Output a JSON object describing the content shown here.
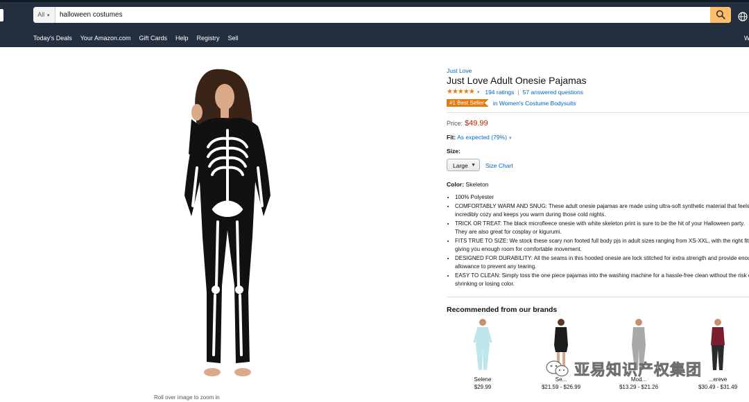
{
  "header": {
    "search_category": "All",
    "search_query": "halloween costumes",
    "nav_links": [
      "Today's Deals",
      "Your Amazon.com",
      "Gift Cards",
      "Help",
      "Registry",
      "Sell"
    ],
    "nav_edge": "W",
    "accent_color": "#febd69",
    "bar_color": "#232f3e"
  },
  "product": {
    "brand": "Just Love",
    "title": "Just Love Adult Onesie Pajamas",
    "stars": "★★★★★",
    "ratings_text": "194 ratings",
    "answered_text": "57 answered questions",
    "best_seller_badge": "#1 Best Seller",
    "best_seller_category": "in Women's Costume Bodysuits",
    "price_label": "Price:",
    "price": "$49.99",
    "fit_label": "Fit:",
    "fit_value": "As expected (79%)",
    "size_label": "Size:",
    "size_selected": "Large",
    "size_chart_link": "Size Chart",
    "color_label": "Color:",
    "color_value": "Skeleton",
    "bullets": [
      "100% Polyester",
      "COMFORTABLY WARM AND SNUG: These adult onesie pajamas are made using ultra-soft synthetic material that feels incredibly cozy and keeps you warm during those cold nights.",
      "TRICK OR TREAT: The black microfleece onesie with white skeleton print is sure to be the hit of your Halloween party. They are also great for cosplay or kigurumi.",
      "FITS TRUE TO SIZE: We stock these scary non footed full body pjs in adult sizes ranging from XS-XXL, with the right fit giving you enough room for comfortable movement.",
      "DESIGNED FOR DURABILITY: All the seams in this hooded onesie are lock stitched for extra strength and provide enough allowance to prevent any tearing.",
      "EASY TO CLEAN: Simply toss the one piece pajamas into the washing machine for a hassle-free clean without the risk of shrinking or losing color."
    ],
    "image_caption": "Roll over image to zoom in",
    "price_color": "#b12704",
    "badge_color": "#e47911"
  },
  "recommendations": {
    "title": "Recommended from our brands",
    "items": [
      {
        "name": "Selene",
        "price": "$29.99",
        "color": "#bfe6ea"
      },
      {
        "name": "Se...",
        "price": "$21.59 - $26.99",
        "color": "#1c1c1c"
      },
      {
        "name": "Mod...",
        "price": "$13.29 - $21.26",
        "color": "#a9a9a9"
      },
      {
        "name": "...ereve",
        "price": "$30.49 - $31.49",
        "color": "#7a1d2c"
      }
    ]
  },
  "watermark": {
    "text": "亚易知识产权集团",
    "icon": "wechat-icon"
  }
}
